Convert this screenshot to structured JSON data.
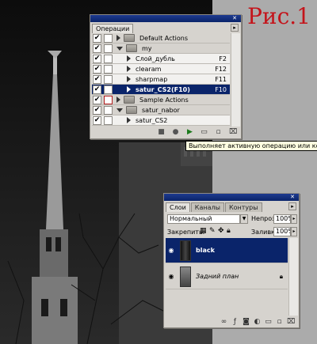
{
  "figure_label": "Рис.1",
  "actions_panel": {
    "tab": "Операции",
    "rows": [
      {
        "label": "Default Actions",
        "key": "",
        "type": "set",
        "expanded": false,
        "checked": true
      },
      {
        "label": "my",
        "key": "",
        "type": "set",
        "expanded": true,
        "checked": true
      },
      {
        "label": "Слой_дубль",
        "key": "F2",
        "type": "action",
        "checked": true
      },
      {
        "label": "clearam",
        "key": "F12",
        "type": "action",
        "checked": true
      },
      {
        "label": "sharpmap",
        "key": "F11",
        "type": "action",
        "checked": true
      },
      {
        "label": "satur_CS2(F10)",
        "key": "F10",
        "type": "action",
        "checked": true,
        "selected": true
      },
      {
        "label": "Sample Actions",
        "key": "",
        "type": "set",
        "expanded": false,
        "checked": true,
        "dialog_red": true
      },
      {
        "label": "satur_nabor",
        "key": "",
        "type": "set",
        "expanded": true,
        "checked": true
      },
      {
        "label": "satur_CS2",
        "key": "",
        "type": "action",
        "checked": true
      }
    ],
    "buttons": {
      "stop": "■",
      "record": "●",
      "play": "▶",
      "new_set": "▭",
      "new_action": "▫",
      "delete": "🗑"
    },
    "tooltip": "Выполняет активную операцию или команду"
  },
  "layers_panel": {
    "tabs": [
      "Слои",
      "Каналы",
      "Контуры"
    ],
    "blend_mode": "Нормальный",
    "opacity_label": "Непрозр.:",
    "opacity_value": "100%",
    "lock_label": "Закрепить:",
    "fill_label": "Заливка:",
    "fill_value": "100%",
    "layers": [
      {
        "name": "black",
        "selected": true
      },
      {
        "name": "Задний план",
        "selected": false,
        "locked": true
      }
    ],
    "bottom_icons": [
      "link",
      "fx",
      "mask",
      "adjustment",
      "group",
      "new-layer",
      "delete"
    ]
  },
  "colors": {
    "selection": "#0a246a",
    "figure_label": "#c4141b",
    "tooltip_bg": "#ffffe1"
  }
}
